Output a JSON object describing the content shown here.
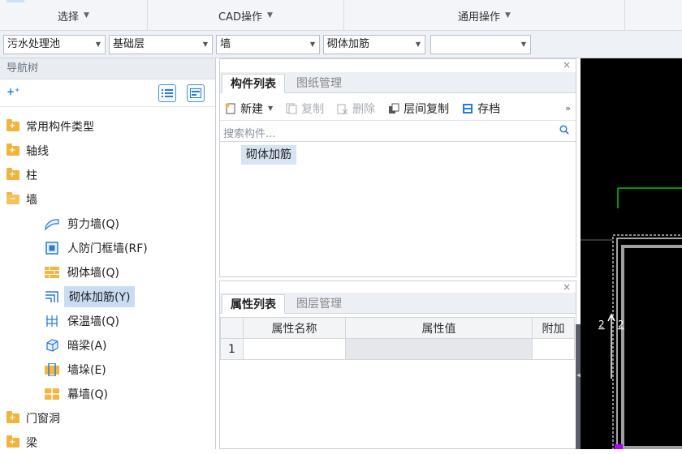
{
  "ribbon": {
    "groups": [
      {
        "label": "选择"
      },
      {
        "label": "CAD操作"
      },
      {
        "label": "通用操作"
      }
    ]
  },
  "selectors": {
    "project": "污水处理池",
    "floor": "基础层",
    "category": "墙",
    "component": "砌体加筋",
    "extra": ""
  },
  "nav": {
    "title": "导航树",
    "top_items": [
      {
        "label": "常用构件类型"
      },
      {
        "label": "轴线"
      },
      {
        "label": "柱"
      },
      {
        "label": "墙"
      }
    ],
    "wall_children": [
      {
        "label": "剪力墙(Q)",
        "icon": "shear-wall-icon"
      },
      {
        "label": "人防门框墙(RF)",
        "icon": "civil-defense-door-wall-icon"
      },
      {
        "label": "砌体墙(Q)",
        "icon": "masonry-wall-icon"
      },
      {
        "label": "砌体加筋(Y)",
        "icon": "masonry-rebar-icon",
        "selected": true
      },
      {
        "label": "保温墙(Q)",
        "icon": "insulation-wall-icon"
      },
      {
        "label": "暗梁(A)",
        "icon": "hidden-beam-icon"
      },
      {
        "label": "墙垛(E)",
        "icon": "wall-pier-icon"
      },
      {
        "label": "幕墙(Q)",
        "icon": "curtain-wall-icon"
      }
    ],
    "bottom_items": [
      {
        "label": "门窗洞"
      },
      {
        "label": "梁"
      }
    ]
  },
  "component_panel": {
    "tabs": [
      "构件列表",
      "图纸管理"
    ],
    "toolbar": {
      "new": "新建",
      "copy": "复制",
      "delete": "删除",
      "floor_copy": "层间复制",
      "archive": "存档",
      "more": "»"
    },
    "search_placeholder": "搜索构件...",
    "items": [
      "砌体加筋"
    ]
  },
  "property_panel": {
    "tabs": [
      "属性列表",
      "图层管理"
    ],
    "columns": [
      "属性名称",
      "属性值",
      "附加"
    ],
    "rows": [
      {
        "index": "1",
        "name": "",
        "value": "",
        "extra": ""
      }
    ]
  },
  "cad": {
    "labels": [
      "2",
      "2"
    ]
  },
  "colors": {
    "accent": "#2a7bd6",
    "selection": "#c9dcf2",
    "cad_background": "#000000",
    "cad_green": "#00c800",
    "cad_magenta": "#b000ff"
  }
}
